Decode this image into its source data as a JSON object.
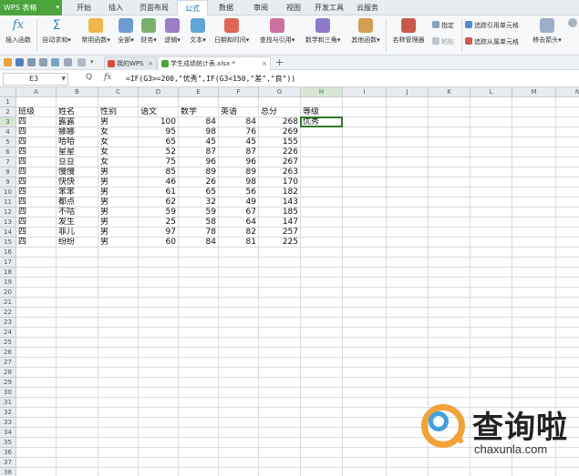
{
  "app": {
    "menu_label": "WPS 表格",
    "menu_caret": "▾"
  },
  "ribbon_tabs": [
    "开始",
    "插入",
    "页面布局",
    "公式",
    "数据",
    "审阅",
    "视图",
    "开发工具",
    "云服务"
  ],
  "active_tab": "公式",
  "ribbon": {
    "insert_function": "插入函数",
    "autosum": "自动求和▾",
    "common_functions": "常用函数▾",
    "all": "全部▾",
    "finance": "财务▾",
    "logic": "逻辑▾",
    "text": "文本▾",
    "datetime": "日期和时间▾",
    "lookup": "查找与引用▾",
    "math": "数学和三角▾",
    "other": "其他函数▾",
    "name_manager": "名称管理器",
    "specify": "指定",
    "paste": "粘贴",
    "trace_precedents": "追踪引用单元格",
    "trace_dependents": "追踪从属单元格",
    "remove_arrows": "移去箭头▾"
  },
  "doc_tabs": [
    {
      "label": "我的WPS",
      "close": "×"
    },
    {
      "label": "学生成绩统计表.xlsx *",
      "close": "×"
    }
  ],
  "new_tab": "+",
  "formula_bar": {
    "name_box": "E3",
    "fx_label": "fx",
    "zoom_icon": "Q",
    "formula": "=IF(G3>=200,\"优秀\",IF(G3<150,\"差\",\"良\"))"
  },
  "columns": [
    "A",
    "B",
    "C",
    "D",
    "E",
    "F",
    "G",
    "H",
    "I",
    "J",
    "K",
    "L",
    "M",
    "N"
  ],
  "rows": [
    "1",
    "2",
    "3",
    "4",
    "5",
    "6",
    "7",
    "8",
    "9",
    "10",
    "11",
    "12",
    "13",
    "14",
    "15",
    "16",
    "17",
    "18",
    "19",
    "20",
    "21",
    "22",
    "23",
    "24",
    "25",
    "26",
    "27",
    "28",
    "29",
    "30",
    "31",
    "32",
    "33",
    "34",
    "35",
    "36",
    "37",
    "38"
  ],
  "headers": [
    "班级",
    "姓名",
    "性别",
    "语文",
    "数学",
    "英语",
    "总分",
    "等级"
  ],
  "table": [
    [
      "四",
      "露露",
      "男",
      "100",
      "84",
      "84",
      "268",
      "优秀"
    ],
    [
      "四",
      "娜娜",
      "女",
      "95",
      "98",
      "76",
      "269",
      ""
    ],
    [
      "四",
      "哈哈",
      "女",
      "65",
      "45",
      "45",
      "155",
      ""
    ],
    [
      "四",
      "星星",
      "女",
      "52",
      "87",
      "87",
      "226",
      ""
    ],
    [
      "四",
      "豆豆",
      "女",
      "75",
      "96",
      "96",
      "267",
      ""
    ],
    [
      "四",
      "慢慢",
      "男",
      "85",
      "89",
      "89",
      "263",
      ""
    ],
    [
      "四",
      "快快",
      "男",
      "46",
      "26",
      "98",
      "170",
      ""
    ],
    [
      "四",
      "笨笨",
      "男",
      "61",
      "65",
      "56",
      "182",
      ""
    ],
    [
      "四",
      "都点",
      "男",
      "62",
      "32",
      "49",
      "143",
      ""
    ],
    [
      "四",
      "不咕",
      "男",
      "59",
      "59",
      "67",
      "185",
      ""
    ],
    [
      "四",
      "发生",
      "男",
      "25",
      "58",
      "64",
      "147",
      ""
    ],
    [
      "四",
      "菲儿",
      "男",
      "97",
      "78",
      "82",
      "257",
      ""
    ],
    [
      "四",
      "纷纷",
      "男",
      "60",
      "84",
      "81",
      "225",
      ""
    ]
  ],
  "watermark": {
    "cn": "查询啦",
    "url": "chaxunla.com"
  }
}
